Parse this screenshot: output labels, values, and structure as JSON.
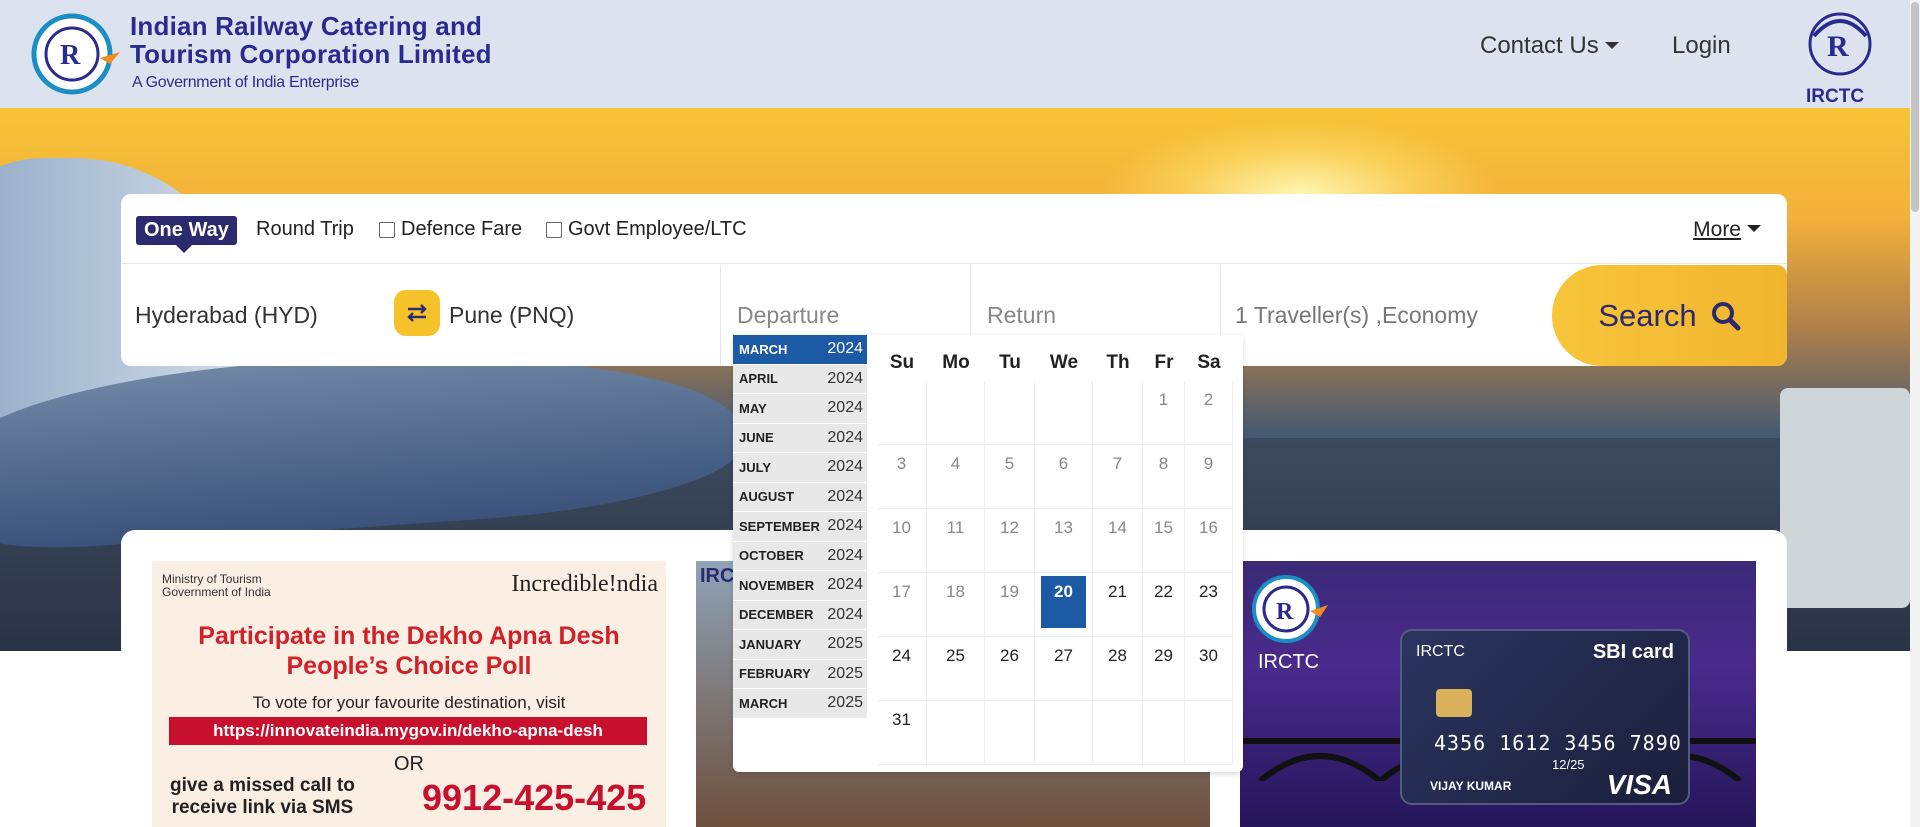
{
  "header": {
    "org_line1": "Indian  Railway  Catering  and",
    "org_line2": "Tourism Corporation Limited",
    "org_line3": "A Government of India Enterprise",
    "contact": "Contact Us",
    "login": "Login",
    "brand": "IRCTC"
  },
  "search": {
    "one_way": "One Way",
    "round_trip": "Round Trip",
    "defence_fare": "Defence Fare",
    "govt_employee": "Govt Employee/LTC",
    "more": "More",
    "from": "Hyderabad (HYD)",
    "to": "Pune (PNQ)",
    "departure_placeholder": "Departure",
    "return_placeholder": "Return",
    "travellers": "1 Traveller(s) ,Economy",
    "search_label": "Search"
  },
  "calendar": {
    "months": [
      {
        "name": "MARCH",
        "year": "2024",
        "active": true
      },
      {
        "name": "APRIL",
        "year": "2024"
      },
      {
        "name": "MAY",
        "year": "2024"
      },
      {
        "name": "JUNE",
        "year": "2024"
      },
      {
        "name": "JULY",
        "year": "2024"
      },
      {
        "name": "AUGUST",
        "year": "2024"
      },
      {
        "name": "SEPTEMBER",
        "year": "2024"
      },
      {
        "name": "OCTOBER",
        "year": "2024"
      },
      {
        "name": "NOVEMBER",
        "year": "2024"
      },
      {
        "name": "DECEMBER",
        "year": "2024"
      },
      {
        "name": "JANUARY",
        "year": "2025"
      },
      {
        "name": "FEBRUARY",
        "year": "2025"
      },
      {
        "name": "MARCH",
        "year": "2025"
      }
    ],
    "weekdays": [
      "Su",
      "Mo",
      "Tu",
      "We",
      "Th",
      "Fr",
      "Sa"
    ],
    "weeks": [
      [
        "",
        "",
        "",
        "",
        "",
        "1",
        "2"
      ],
      [
        "3",
        "4",
        "5",
        "6",
        "7",
        "8",
        "9"
      ],
      [
        "10",
        "11",
        "12",
        "13",
        "14",
        "15",
        "16"
      ],
      [
        "17",
        "18",
        "19",
        "20",
        "21",
        "22",
        "23"
      ],
      [
        "24",
        "25",
        "26",
        "27",
        "28",
        "29",
        "30"
      ],
      [
        "31",
        "",
        "",
        "",
        "",
        "",
        ""
      ]
    ],
    "selected": "20"
  },
  "banner1": {
    "ministry_line1": "Ministry of Tourism",
    "ministry_line2": "Government of India",
    "incredible": "Incredible!ndia",
    "title_line1": "Participate in the Dekho Apna Desh",
    "title_line2": "People’s Choice Poll",
    "vote_text": "To vote for your favourite destination, visit",
    "url": "https://innovateindia.mygov.in/dekho-apna-desh",
    "or": "OR",
    "call_line1": "give a missed call to",
    "call_line2": "receive link via SMS",
    "number": "9912-425-425"
  },
  "banner2": {
    "label": "IRCT"
  },
  "banner3": {
    "label": "IRCTC",
    "card_brand": "IRCTC",
    "sbi": "SBI card",
    "card_number": "4356 1612 3456 7890",
    "expiry": "12/25",
    "holder": "VIJAY KUMAR",
    "network": "VISA"
  },
  "colors": {
    "header_bg": "#dde3ee",
    "brand_blue": "#2b2a8f",
    "accent_yellow": "#f5c22b",
    "selected_blue": "#1c5aa6"
  }
}
